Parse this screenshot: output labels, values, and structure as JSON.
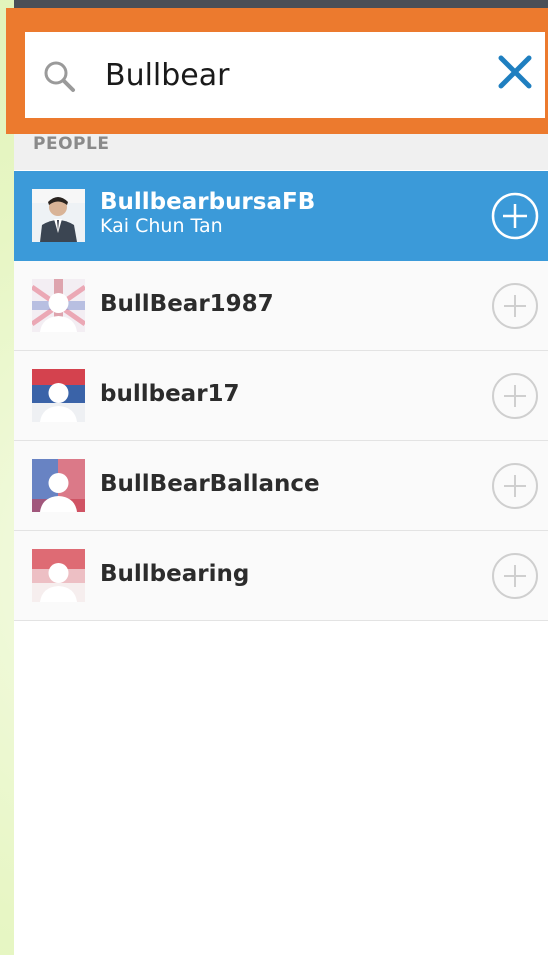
{
  "search": {
    "value": "Bullbear",
    "icon": "search-icon",
    "clear_icon": "close-icon",
    "accent": "#1f7fc0",
    "highlight_color": "#ec7a2e"
  },
  "section": {
    "label": "PEOPLE"
  },
  "people": [
    {
      "name": "BullbearbursaFB",
      "subtitle": "Kai Chun Tan",
      "selected": true,
      "action_icon": "add-circle-icon"
    },
    {
      "name": "BullBear1987",
      "subtitle": "",
      "selected": false,
      "action_icon": "add-circle-icon"
    },
    {
      "name": "bullbear17",
      "subtitle": "",
      "selected": false,
      "action_icon": "add-circle-icon"
    },
    {
      "name": "BullBearBallance",
      "subtitle": "",
      "selected": false,
      "action_icon": "add-circle-icon"
    },
    {
      "name": "Bullbearing",
      "subtitle": "",
      "selected": false,
      "action_icon": "add-circle-icon"
    }
  ],
  "colors": {
    "selected_row": "#3b9ad9",
    "row_background": "#fafafa"
  }
}
